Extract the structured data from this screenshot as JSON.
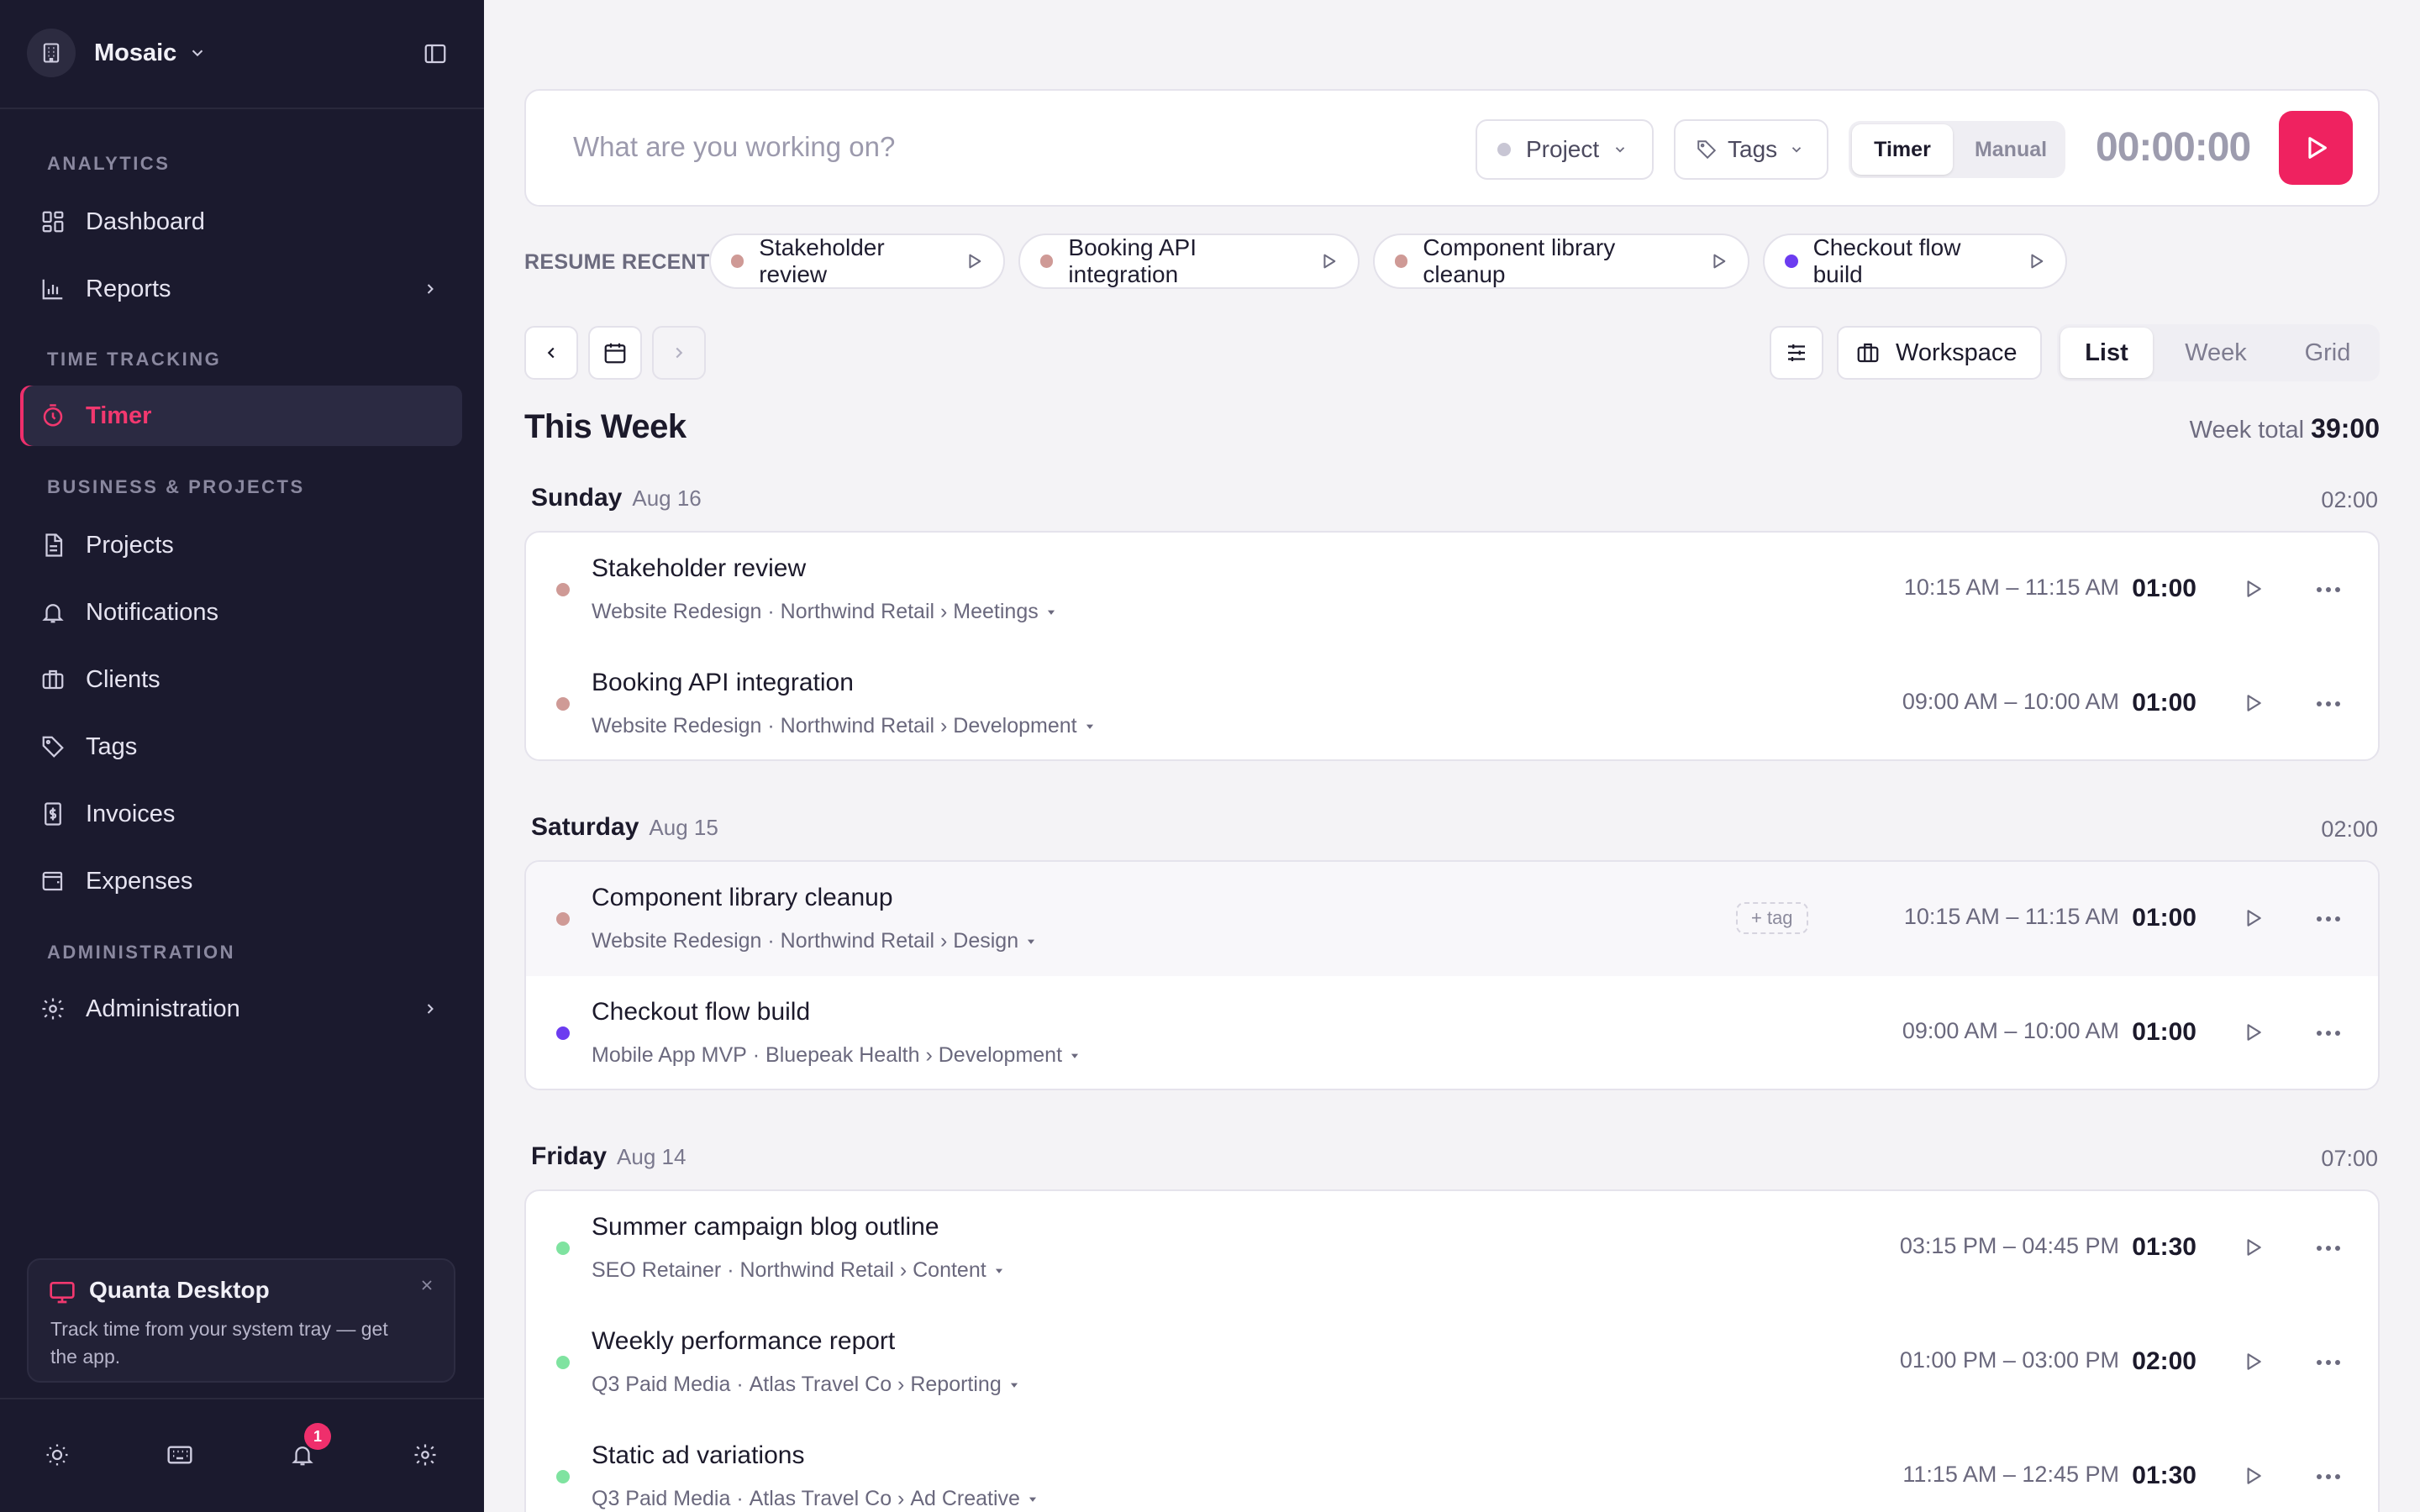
{
  "workspace": {
    "name": "Mosaic"
  },
  "sidebar": {
    "sections": {
      "analytics": "ANALYTICS",
      "time_tracking": "TIME TRACKING",
      "business": "BUSINESS & PROJECTS",
      "admin": "ADMINISTRATION"
    },
    "items": [
      {
        "label": "Dashboard",
        "icon": "dashboard-icon"
      },
      {
        "label": "Reports",
        "icon": "reports-icon"
      },
      {
        "label": "Timer",
        "icon": "timer-icon",
        "active": true
      },
      {
        "label": "Projects",
        "icon": "projects-icon"
      },
      {
        "label": "Notifications",
        "icon": "bell-icon"
      },
      {
        "label": "Clients",
        "icon": "briefcase-icon"
      },
      {
        "label": "Tags",
        "icon": "tag-icon"
      },
      {
        "label": "Invoices",
        "icon": "invoice-icon"
      },
      {
        "label": "Expenses",
        "icon": "wallet-icon"
      },
      {
        "label": "Administration",
        "icon": "gear-icon"
      }
    ],
    "promo": {
      "title": "Quanta Desktop",
      "text": "Track time from your system tray — get the app."
    },
    "notifications_badge": "1"
  },
  "timer": {
    "placeholder": "What are you working on?",
    "project_label": "Project",
    "tags_label": "Tags",
    "mode_timer": "Timer",
    "mode_manual": "Manual",
    "clock": "00:00:00"
  },
  "resume_recent": {
    "label": "RESUME RECENT",
    "items": [
      {
        "label": "Stakeholder review",
        "color": "#cf9a96"
      },
      {
        "label": "Booking API integration",
        "color": "#cf9a96"
      },
      {
        "label": "Component library cleanup",
        "color": "#cf9a96"
      },
      {
        "label": "Checkout flow build",
        "color": "#6c3cf0"
      }
    ]
  },
  "toolbar": {
    "workspace_label": "Workspace",
    "views": [
      "List",
      "Week",
      "Grid"
    ],
    "active_view": "List"
  },
  "week": {
    "title": "This Week",
    "total_label": "Week total",
    "total": "39:00"
  },
  "days": [
    {
      "name": "Sunday",
      "date": "Aug 16",
      "total": "02:00",
      "entries": [
        {
          "title": "Stakeholder review",
          "project": "Website Redesign",
          "client": "Northwind Retail",
          "task": "Meetings",
          "range": "10:15 AM – 11:15 AM",
          "duration": "01:00",
          "color": "#cf9a96"
        },
        {
          "title": "Booking API integration",
          "project": "Website Redesign",
          "client": "Northwind Retail",
          "task": "Development",
          "range": "09:00 AM – 10:00 AM",
          "duration": "01:00",
          "color": "#cf9a96"
        }
      ]
    },
    {
      "name": "Saturday",
      "date": "Aug 15",
      "total": "02:00",
      "entries": [
        {
          "title": "Component library cleanup",
          "project": "Website Redesign",
          "client": "Northwind Retail",
          "task": "Design",
          "range": "10:15 AM – 11:15 AM",
          "duration": "01:00",
          "color": "#cf9a96",
          "tag": "+ tag"
        },
        {
          "title": "Checkout flow build",
          "project": "Mobile App MVP",
          "client": "Bluepeak Health",
          "task": "Development",
          "range": "09:00 AM – 10:00 AM",
          "duration": "01:00",
          "color": "#6c3cf0"
        }
      ]
    },
    {
      "name": "Friday",
      "date": "Aug 14",
      "total": "07:00",
      "entries": [
        {
          "title": "Summer campaign blog outline",
          "project": "SEO Retainer",
          "client": "Northwind Retail",
          "task": "Content",
          "range": "03:15 PM – 04:45 PM",
          "duration": "01:30",
          "color": "#7fe3a0"
        },
        {
          "title": "Weekly performance report",
          "project": "Q3 Paid Media",
          "client": "Atlas Travel Co",
          "task": "Reporting",
          "range": "01:00 PM – 03:00 PM",
          "duration": "02:00",
          "color": "#7fe3a0"
        },
        {
          "title": "Static ad variations",
          "project": "Q3 Paid Media",
          "client": "Atlas Travel Co",
          "task": "Ad Creative",
          "range": "11:15 AM – 12:45 PM",
          "duration": "01:30",
          "color": "#7fe3a0"
        }
      ]
    }
  ]
}
